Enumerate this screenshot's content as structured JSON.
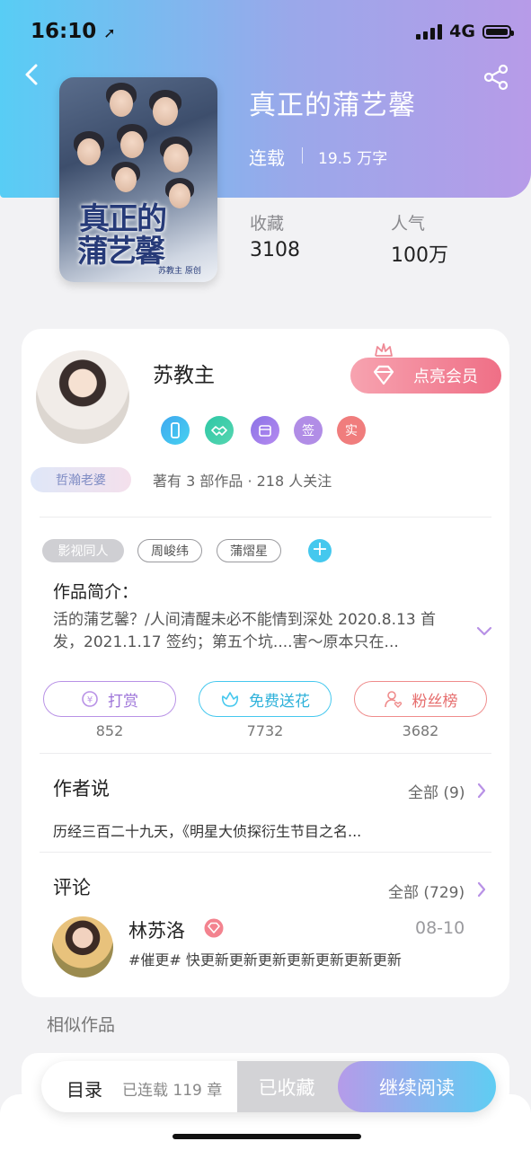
{
  "status_bar": {
    "time": "16:10",
    "network": "4G"
  },
  "book": {
    "title": "真正的蒲艺馨",
    "status": "连载",
    "words": "19.5 万字",
    "cover_title_line1": "真正的",
    "cover_title_line2": "蒲艺馨",
    "cover_subtitle": "苏教主 原创",
    "stats": [
      {
        "label": "收藏",
        "value": "3108"
      },
      {
        "label": "人气",
        "value": "100万"
      }
    ]
  },
  "author": {
    "name": "苏教主",
    "badge": "哲瀚老婆",
    "vip_button": "点亮会员",
    "honor_badges": [
      "签",
      "实"
    ],
    "meta": "著有 3 部作品 · 218 人关注"
  },
  "tags": [
    "影视同人",
    "周峻纬",
    "蒲熠星"
  ],
  "intro": {
    "title": "作品简介：",
    "text": "活的蒲艺馨？/人间清醒未必不能情到深处 2020.8.13 首发，2021.1.17 签约；第五个坑....害～原本只在..."
  },
  "actions": [
    {
      "label": "打赏",
      "count": "852"
    },
    {
      "label": "免费送花",
      "count": "7732"
    },
    {
      "label": "粉丝榜",
      "count": "3682"
    }
  ],
  "author_says": {
    "title": "作者说",
    "more": "全部 (9)",
    "text": "历经三百二十九天，《明星大侦探衍生节目之名..."
  },
  "comments": {
    "title": "评论",
    "more": "全部 (729)",
    "items": [
      {
        "user": "林苏洛",
        "date": "08-10",
        "text": "#催更# 快更新更新更新更新更新更新更新"
      }
    ]
  },
  "similar_title": "相似作品",
  "bottom_bar": {
    "toc": "目录",
    "chapters": "已连载 119 章",
    "collected": "已收藏",
    "continue": "继续阅读"
  },
  "colors": {
    "accent_blue": "#45c8ee",
    "accent_purple": "#b59be9",
    "accent_red": "#ef6f86"
  }
}
